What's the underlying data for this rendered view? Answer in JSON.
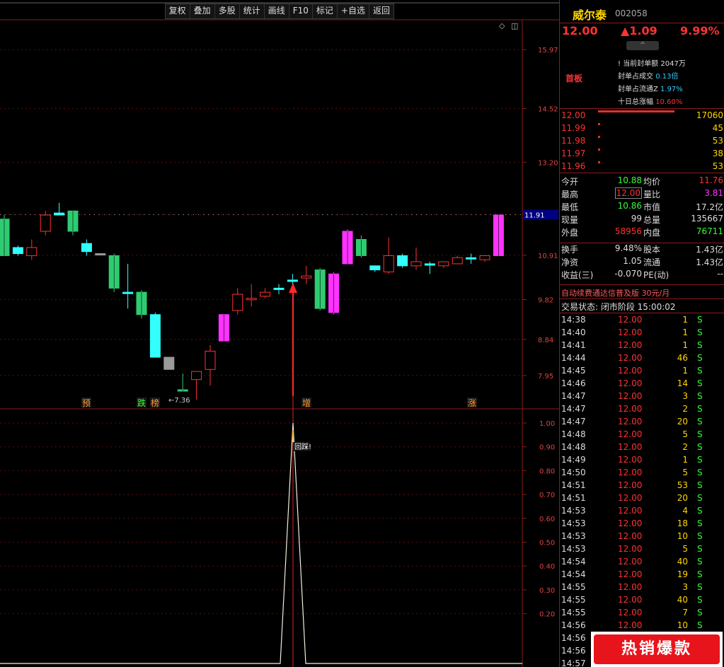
{
  "toolbar": [
    "复权",
    "叠加",
    "多股",
    "统计",
    "画线",
    "F10",
    "标记",
    "+自选",
    "返回"
  ],
  "price_axis": [
    "15.97",
    "14.52",
    "13.20",
    "11.91",
    "10.91",
    "9.82",
    "8.84",
    "7.95"
  ],
  "current_price_label": "11.91",
  "low_marker": "←7.36",
  "annotations": [
    {
      "text": "预",
      "color": "#ff9933"
    },
    {
      "text": "跌",
      "color": "#33ff33"
    },
    {
      "text": "榜",
      "color": "#ff9933"
    },
    {
      "text": "增",
      "color": "#ff9933"
    },
    {
      "text": "涨",
      "color": "#ff9933"
    }
  ],
  "indicator_axis": [
    "1.00",
    "0.90",
    "0.80",
    "0.70",
    "0.60",
    "0.50",
    "0.40",
    "0.30",
    "0.20"
  ],
  "indicator_label": "回踩!",
  "stock": {
    "name": "威尔泰",
    "code": "002058",
    "price": "12.00",
    "change": "▲1.09",
    "pct": "9.99%"
  },
  "seal": {
    "tag": "首板",
    "lines": [
      {
        "label": "! 当前封单额",
        "value": "2047万",
        "color": "#dddddd"
      },
      {
        "label": "封单占成交",
        "value": "0.13倍",
        "color": "#33ccff"
      },
      {
        "label": "封单占流通Z",
        "value": "1.97%",
        "color": "#33ccff"
      },
      {
        "label": "十日总涨幅",
        "value": "10.60%",
        "color": "#ff3232"
      }
    ]
  },
  "order_book": [
    {
      "price": "12.00",
      "vol": "17060",
      "bar": 0.9
    },
    {
      "price": "11.99",
      "vol": "45",
      "bar": 0.02
    },
    {
      "price": "11.98",
      "vol": "53",
      "bar": 0.02
    },
    {
      "price": "11.97",
      "vol": "38",
      "bar": 0.02
    },
    {
      "price": "11.96",
      "vol": "53",
      "bar": 0.02
    }
  ],
  "quote": [
    [
      {
        "k": "今开",
        "v": "10.88",
        "c": "#33ff33"
      },
      {
        "k": "均价",
        "v": "11.76",
        "c": "#ff3232"
      }
    ],
    [
      {
        "k": "最高",
        "v": "12.00",
        "c": "#ff3232"
      },
      {
        "k": "量比",
        "v": "3.81",
        "c": "#ff33ff"
      }
    ],
    [
      {
        "k": "最低",
        "v": "10.86",
        "c": "#33ff33"
      },
      {
        "k": "市值",
        "v": "17.2亿",
        "c": "#dddddd"
      }
    ],
    [
      {
        "k": "现量",
        "v": "99",
        "c": "#dddddd"
      },
      {
        "k": "总量",
        "v": "135667",
        "c": "#dddddd"
      }
    ],
    [
      {
        "k": "外盘",
        "v": "58956",
        "c": "#ff3232"
      },
      {
        "k": "内盘",
        "v": "76711",
        "c": "#33ff33"
      }
    ],
    [
      {
        "k": "换手",
        "v": "9.48%",
        "c": "#dddddd"
      },
      {
        "k": "股本",
        "v": "1.43亿",
        "c": "#dddddd"
      }
    ],
    [
      {
        "k": "净资",
        "v": "1.05",
        "c": "#dddddd"
      },
      {
        "k": "流通",
        "v": "1.43亿",
        "c": "#dddddd"
      }
    ],
    [
      {
        "k": "收益(三)",
        "v": "-0.070",
        "c": "#dddddd"
      },
      {
        "k": "PE(动)",
        "v": "--",
        "c": "#dddddd"
      }
    ]
  ],
  "promo": "自动续费通达信普及版 30元/月",
  "trade_status": "交易状态: 闭市阶段 15:00:02",
  "ticks": [
    [
      "14:38",
      "12.00",
      "1",
      "S"
    ],
    [
      "14:40",
      "12.00",
      "1",
      "S"
    ],
    [
      "14:41",
      "12.00",
      "1",
      "S"
    ],
    [
      "14:44",
      "12.00",
      "46",
      "S"
    ],
    [
      "14:45",
      "12.00",
      "1",
      "S"
    ],
    [
      "14:46",
      "12.00",
      "14",
      "S"
    ],
    [
      "14:47",
      "12.00",
      "3",
      "S"
    ],
    [
      "14:47",
      "12.00",
      "2",
      "S"
    ],
    [
      "14:47",
      "12.00",
      "20",
      "S"
    ],
    [
      "14:48",
      "12.00",
      "5",
      "S"
    ],
    [
      "14:48",
      "12.00",
      "2",
      "S"
    ],
    [
      "14:49",
      "12.00",
      "1",
      "S"
    ],
    [
      "14:50",
      "12.00",
      "5",
      "S"
    ],
    [
      "14:51",
      "12.00",
      "53",
      "S"
    ],
    [
      "14:51",
      "12.00",
      "20",
      "S"
    ],
    [
      "14:53",
      "12.00",
      "4",
      "S"
    ],
    [
      "14:53",
      "12.00",
      "18",
      "S"
    ],
    [
      "14:53",
      "12.00",
      "10",
      "S"
    ],
    [
      "14:53",
      "12.00",
      "5",
      "S"
    ],
    [
      "14:54",
      "12.00",
      "40",
      "S"
    ],
    [
      "14:54",
      "12.00",
      "19",
      "S"
    ],
    [
      "14:55",
      "12.00",
      "3",
      "S"
    ],
    [
      "14:55",
      "12.00",
      "40",
      "S"
    ],
    [
      "14:55",
      "12.00",
      "7",
      "S"
    ],
    [
      "14:56",
      "12.00",
      "10",
      "S"
    ],
    [
      "14:56",
      "",
      "",
      " "
    ],
    [
      "14:56",
      "",
      "",
      ""
    ],
    [
      "14:57",
      "",
      "",
      ""
    ]
  ],
  "badge": "热销爆款",
  "chart_data": {
    "type": "candlestick",
    "y_axis_ticks": [
      15.97,
      14.52,
      13.2,
      11.91,
      10.91,
      9.82,
      8.84,
      7.95
    ],
    "candles": [
      {
        "o": 10.9,
        "c": 11.8,
        "h": 11.9,
        "l": 10.9,
        "color": "green"
      },
      {
        "o": 10.95,
        "c": 11.1,
        "h": 11.15,
        "l": 10.9,
        "color": "cyan"
      },
      {
        "o": 10.9,
        "c": 11.1,
        "h": 11.3,
        "l": 10.8,
        "color": "red"
      },
      {
        "o": 11.5,
        "c": 11.9,
        "h": 12.0,
        "l": 11.4,
        "color": "red"
      },
      {
        "o": 11.95,
        "c": 11.9,
        "h": 12.2,
        "l": 11.9,
        "color": "cyan"
      },
      {
        "o": 12.0,
        "c": 11.5,
        "h": 12.0,
        "l": 11.4,
        "color": "green"
      },
      {
        "o": 11.2,
        "c": 11.0,
        "h": 11.3,
        "l": 10.9,
        "color": "cyan"
      },
      {
        "o": 10.95,
        "c": 10.95,
        "h": 10.95,
        "l": 10.95,
        "color": "gray"
      },
      {
        "o": 10.9,
        "c": 10.1,
        "h": 10.95,
        "l": 10.0,
        "color": "green"
      },
      {
        "o": 10.0,
        "c": 10.0,
        "h": 10.7,
        "l": 9.6,
        "color": "cyan"
      },
      {
        "o": 10.0,
        "c": 9.45,
        "h": 10.05,
        "l": 9.35,
        "color": "green"
      },
      {
        "o": 9.45,
        "c": 8.4,
        "h": 9.5,
        "l": 8.4,
        "color": "cyan"
      },
      {
        "o": 8.4,
        "c": 8.1,
        "h": 8.4,
        "l": 8.1,
        "color": "gray"
      },
      {
        "o": 7.6,
        "c": 7.6,
        "h": 8.0,
        "l": 7.6,
        "color": "green"
      },
      {
        "o": 7.85,
        "c": 8.05,
        "h": 8.05,
        "l": 7.36,
        "color": "red"
      },
      {
        "o": 8.1,
        "c": 8.55,
        "h": 8.7,
        "l": 7.7,
        "color": "red"
      },
      {
        "o": 8.8,
        "c": 9.45,
        "h": 9.45,
        "l": 8.8,
        "color": "magenta"
      },
      {
        "o": 9.55,
        "c": 9.95,
        "h": 10.1,
        "l": 9.45,
        "color": "red"
      },
      {
        "o": 9.85,
        "c": 9.85,
        "h": 10.2,
        "l": 9.65,
        "color": "red"
      },
      {
        "o": 9.9,
        "c": 10.0,
        "h": 10.1,
        "l": 9.85,
        "color": "red"
      },
      {
        "o": 10.1,
        "c": 10.1,
        "h": 10.2,
        "l": 9.95,
        "color": "cyan"
      },
      {
        "o": 10.3,
        "c": 10.3,
        "h": 10.45,
        "l": 10.15,
        "color": "cyan"
      },
      {
        "o": 10.35,
        "c": 10.4,
        "h": 10.65,
        "l": 10.2,
        "color": "red"
      },
      {
        "o": 10.55,
        "c": 9.6,
        "h": 10.6,
        "l": 9.55,
        "color": "green"
      },
      {
        "o": 9.5,
        "c": 10.45,
        "h": 10.5,
        "l": 9.45,
        "color": "magenta"
      },
      {
        "o": 10.7,
        "c": 11.5,
        "h": 11.55,
        "l": 10.7,
        "color": "magenta"
      },
      {
        "o": 11.3,
        "c": 10.9,
        "h": 11.4,
        "l": 10.85,
        "color": "green"
      },
      {
        "o": 10.55,
        "c": 10.65,
        "h": 10.65,
        "l": 10.5,
        "color": "cyan"
      },
      {
        "o": 10.5,
        "c": 10.9,
        "h": 11.35,
        "l": 10.45,
        "color": "red"
      },
      {
        "o": 10.9,
        "c": 10.65,
        "h": 10.95,
        "l": 10.6,
        "color": "cyan"
      },
      {
        "o": 10.65,
        "c": 10.75,
        "h": 11.1,
        "l": 10.55,
        "color": "red"
      },
      {
        "o": 10.7,
        "c": 10.7,
        "h": 10.75,
        "l": 10.45,
        "color": "cyan"
      },
      {
        "o": 10.65,
        "c": 10.75,
        "h": 10.75,
        "l": 10.6,
        "color": "red"
      },
      {
        "o": 10.7,
        "c": 10.85,
        "h": 10.9,
        "l": 10.7,
        "color": "red"
      },
      {
        "o": 10.85,
        "c": 10.85,
        "h": 10.95,
        "l": 10.7,
        "color": "cyan"
      },
      {
        "o": 10.8,
        "c": 10.9,
        "h": 10.9,
        "l": 10.75,
        "color": "red"
      },
      {
        "o": 10.9,
        "c": 11.9,
        "h": 11.9,
        "l": 10.9,
        "color": "magenta"
      }
    ],
    "indicator": {
      "signal_index": 23,
      "values_at_signal": 1.0,
      "baseline": 0
    }
  }
}
